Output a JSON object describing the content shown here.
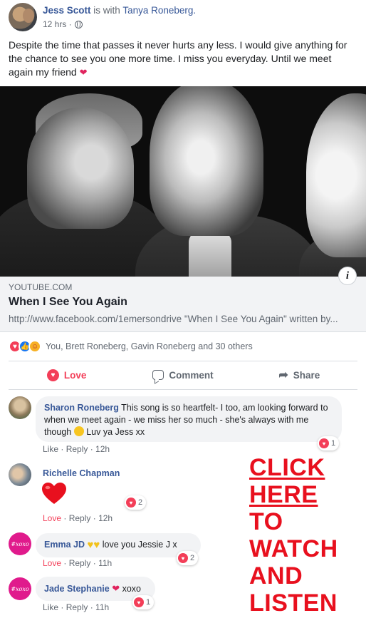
{
  "post": {
    "author": "Jess Scott",
    "with_text": " is with ",
    "tagged": "Tanya Roneberg.",
    "time": "12 hrs ·",
    "text": "Despite the time that passes it never hurts any less. I would give anything for the chance to see you one more time. I miss you everyday. Until we meet again my friend",
    "text_emoji": "❤"
  },
  "link": {
    "source": "YOUTUBE.COM",
    "title": "When I See You Again",
    "description": "http://www.facebook.com/1emersondrive \"When I See You Again\" written by..."
  },
  "reactions": {
    "icons": [
      "love-icon",
      "like-icon",
      "care-icon"
    ],
    "summary": "You, Brett Roneberg, Gavin Roneberg and 30 others"
  },
  "actions": {
    "love": "Love",
    "comment": "Comment",
    "share": "Share"
  },
  "comments": [
    {
      "name": "Sharon Roneberg",
      "text": " This song is so heartfelt- I too, am looking forward to when we meet again - we miss her so much - she's always with me though ",
      "text_after": " Luv ya Jess xx",
      "reaction_count": "1",
      "like": "Like",
      "reply": "Reply",
      "time": "12h"
    },
    {
      "name": "Richelle Chapman",
      "reaction_count": "2",
      "like": "Love",
      "reply": "Reply",
      "time": "12h"
    },
    {
      "name": "Emma JD",
      "text": " love you Jessie J x",
      "reaction_count": "2",
      "like": "Love",
      "reply": "Reply",
      "time": "11h",
      "avatar_text": "#xoxo"
    },
    {
      "name": "Jade Stephanie",
      "text": " xoxo",
      "reaction_count": "1",
      "like": "Like",
      "reply": "Reply",
      "time": "11h",
      "avatar_text": "#xoxo"
    }
  ],
  "cta": {
    "line1": "CLICK",
    "line2": "HERE",
    "line3": "TO",
    "line4": "WATCH",
    "line5": "AND",
    "line6": "LISTEN"
  },
  "colors": {
    "link_blue": "#385898",
    "love_red": "#f33e58",
    "cta_red": "#e8101e",
    "meta_gray": "#606770"
  }
}
